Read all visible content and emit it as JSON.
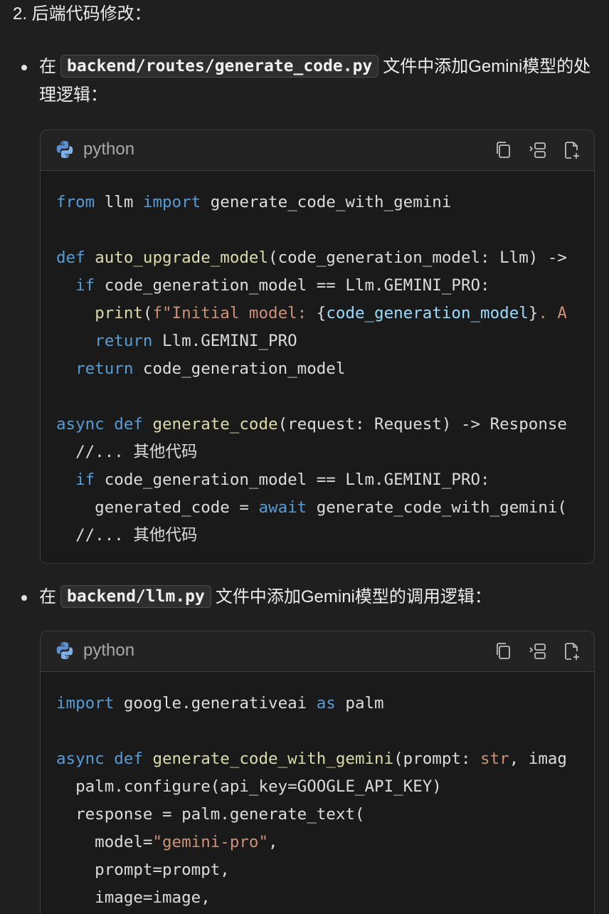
{
  "heading": "2. 后端代码修改：",
  "bullets": [
    {
      "prefix": "在",
      "code": "backend/routes/generate_code.py",
      "suffix": "文件中添加Gemini模型的处理逻辑："
    },
    {
      "prefix": "在",
      "code": "backend/llm.py",
      "suffix": "文件中添加Gemini模型的调用逻辑："
    }
  ],
  "code_blocks": [
    {
      "language": "python",
      "lines": [
        [
          {
            "t": "from",
            "c": "kw"
          },
          {
            "t": " llm ",
            "c": "plain"
          },
          {
            "t": "import",
            "c": "kw"
          },
          {
            "t": " generate_code_with_gemini",
            "c": "plain"
          }
        ],
        [],
        [
          {
            "t": "def",
            "c": "kw"
          },
          {
            "t": " ",
            "c": "plain"
          },
          {
            "t": "auto_upgrade_model",
            "c": "fn"
          },
          {
            "t": "(code_generation_model: Llm) ->",
            "c": "plain"
          }
        ],
        [
          {
            "t": "  ",
            "c": "plain"
          },
          {
            "t": "if",
            "c": "kw"
          },
          {
            "t": " code_generation_model == Llm.GEMINI_PRO:",
            "c": "plain"
          }
        ],
        [
          {
            "t": "    ",
            "c": "plain"
          },
          {
            "t": "print",
            "c": "fn"
          },
          {
            "t": "(",
            "c": "plain"
          },
          {
            "t": "f\"Initial model: ",
            "c": "str"
          },
          {
            "t": "{",
            "c": "plain"
          },
          {
            "t": "code_generation_model",
            "c": "var"
          },
          {
            "t": "}",
            "c": "plain"
          },
          {
            "t": ". A",
            "c": "str"
          }
        ],
        [
          {
            "t": "    ",
            "c": "plain"
          },
          {
            "t": "return",
            "c": "kw"
          },
          {
            "t": " Llm.GEMINI_PRO",
            "c": "plain"
          }
        ],
        [
          {
            "t": "  ",
            "c": "plain"
          },
          {
            "t": "return",
            "c": "kw"
          },
          {
            "t": " code_generation_model",
            "c": "plain"
          }
        ],
        [],
        [
          {
            "t": "async",
            "c": "kw"
          },
          {
            "t": " ",
            "c": "plain"
          },
          {
            "t": "def",
            "c": "kw"
          },
          {
            "t": " ",
            "c": "plain"
          },
          {
            "t": "generate_code",
            "c": "fn"
          },
          {
            "t": "(request: Request) -> Response",
            "c": "plain"
          }
        ],
        [
          {
            "t": "  //... 其他代码",
            "c": "plain"
          }
        ],
        [
          {
            "t": "  ",
            "c": "plain"
          },
          {
            "t": "if",
            "c": "kw"
          },
          {
            "t": " code_generation_model == Llm.GEMINI_PRO:",
            "c": "plain"
          }
        ],
        [
          {
            "t": "    generated_code = ",
            "c": "plain"
          },
          {
            "t": "await",
            "c": "kw"
          },
          {
            "t": " generate_code_with_gemini(",
            "c": "plain"
          }
        ],
        [
          {
            "t": "  //... 其他代码",
            "c": "plain"
          }
        ]
      ]
    },
    {
      "language": "python",
      "lines": [
        [
          {
            "t": "import",
            "c": "kw"
          },
          {
            "t": " google.generativeai ",
            "c": "plain"
          },
          {
            "t": "as",
            "c": "kw"
          },
          {
            "t": " palm",
            "c": "plain"
          }
        ],
        [],
        [
          {
            "t": "async",
            "c": "kw"
          },
          {
            "t": " ",
            "c": "plain"
          },
          {
            "t": "def",
            "c": "kw"
          },
          {
            "t": " ",
            "c": "plain"
          },
          {
            "t": "generate_code_with_gemini",
            "c": "fn"
          },
          {
            "t": "(prompt: ",
            "c": "plain"
          },
          {
            "t": "str",
            "c": "str"
          },
          {
            "t": ", imag",
            "c": "plain"
          }
        ],
        [
          {
            "t": "  palm.configure(api_key=GOOGLE_API_KEY)",
            "c": "plain"
          }
        ],
        [
          {
            "t": "  response = palm.generate_text(",
            "c": "plain"
          }
        ],
        [
          {
            "t": "    model=",
            "c": "plain"
          },
          {
            "t": "\"gemini-pro\"",
            "c": "str"
          },
          {
            "t": ",",
            "c": "plain"
          }
        ],
        [
          {
            "t": "    prompt=prompt,",
            "c": "plain"
          }
        ],
        [
          {
            "t": "    image=image,",
            "c": "plain"
          }
        ]
      ]
    }
  ]
}
